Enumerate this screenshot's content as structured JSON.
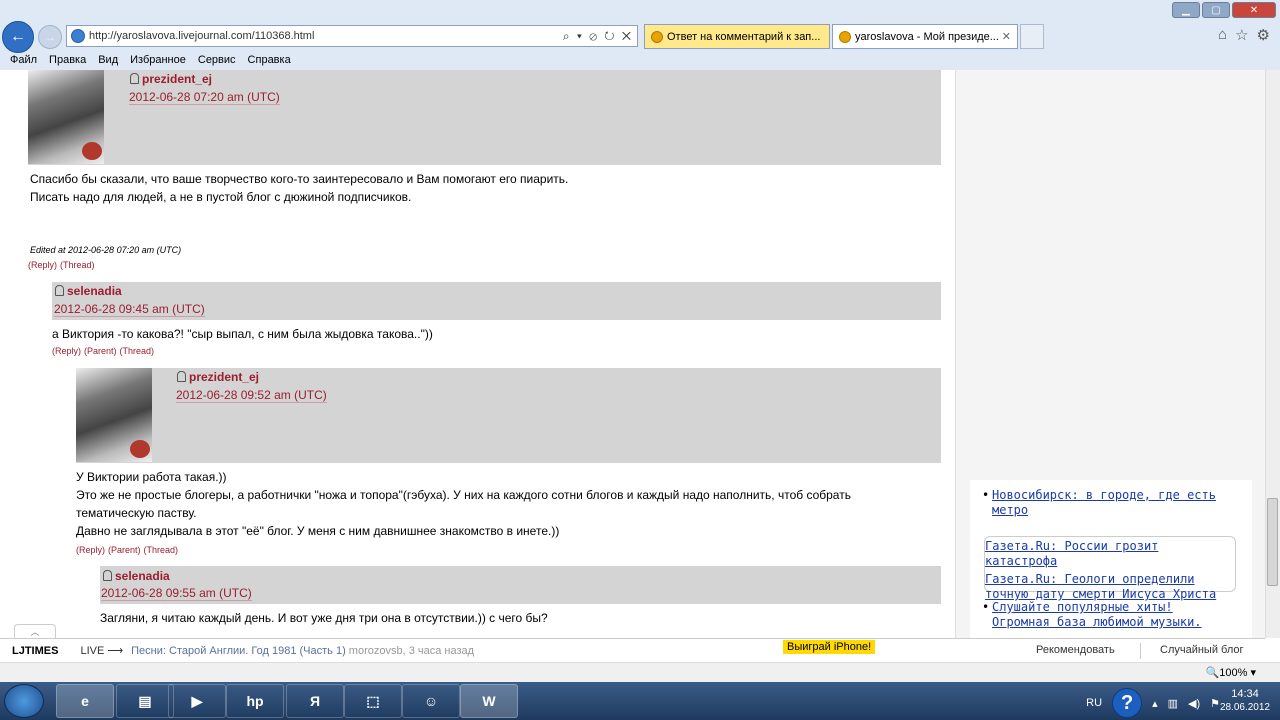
{
  "browser": {
    "url": "http://yaroslavova.livejournal.com/110368.html",
    "address_actions": "⌕ ▾ ⊘ ↻ ✕",
    "tabs": [
      {
        "label": "Ответ на комментарий к зап..."
      },
      {
        "label": "yaroslavova - Мой президе..."
      }
    ],
    "menu": [
      "Файл",
      "Правка",
      "Вид",
      "Избранное",
      "Сервис",
      "Справка"
    ],
    "toolbar_icons": [
      "home-icon",
      "star-icon",
      "gear-icon"
    ]
  },
  "comments": [
    {
      "user": "prezident_ej",
      "date": "2012-06-28 07:20 am (UTC)",
      "lines": [
        "Спасибо бы сказали, что ваше творчество кого-то заинтересовало и Вам помогают его пиарить.",
        "Писать надо для людей, а не в пустой блог с дюжиной подписчиков."
      ],
      "edited": "Edited at 2012-06-28 07:20 am (UTC)",
      "links": [
        "(Reply)",
        "(Thread)"
      ]
    },
    {
      "user": "selenadia",
      "date": "2012-06-28 09:45 am (UTC)",
      "lines": [
        "а Виктория -то какова?! \"сыр выпал, с ним была жыдовка такова..\"))"
      ],
      "links": [
        "(Reply)",
        "(Parent)",
        "(Thread)"
      ]
    },
    {
      "user": "prezident_ej",
      "date": "2012-06-28 09:52 am (UTC)",
      "lines": [
        "У Виктории работа такая.))",
        "Это же не простые блогеры, а работнички \"ножа и топора\"(гэбуха). У них на каждого сотни блогов и каждый надо наполнить, чтоб собрать",
        "тематическую паству.",
        "Давно не заглядывала в этот \"её\" блог. У меня с ним давнишнее знакомство в инете.))"
      ],
      "links": [
        "(Reply)",
        "(Parent)",
        "(Thread)"
      ]
    },
    {
      "user": "selenadia",
      "date": "2012-06-28 09:55 am (UTC)",
      "lines": [
        "Загляни, я читаю каждый день. И вот уже дня три она в отсутствии.)) с чего бы?"
      ]
    }
  ],
  "ads": {
    "item1": "Новосибирск: в городе, где есть метро",
    "gazeta1": "Газета.Ru: России грозит катастрофа",
    "gazeta2": "Газета.Ru: Геологи определили точную дату смерти Иисуса Христа",
    "item3": "Слушайте популярные хиты! Огромная база любимой музыки."
  },
  "ljbar": {
    "logo": "LJTIMES",
    "live": "LIVE ⟶",
    "ticker": "Песни: Старой Англии. Год 1981 (Часть 1)",
    "ticker_user": "morozovsb, 3 часа назад",
    "promo": "Выиграй iPhone!",
    "recommend": "Рекомендовать",
    "random": "Случайный блог"
  },
  "status": {
    "zoom": "🔍100%  ▾"
  },
  "taskbar": {
    "lang": "RU",
    "time": "14:34",
    "date": "28.06.2012"
  }
}
